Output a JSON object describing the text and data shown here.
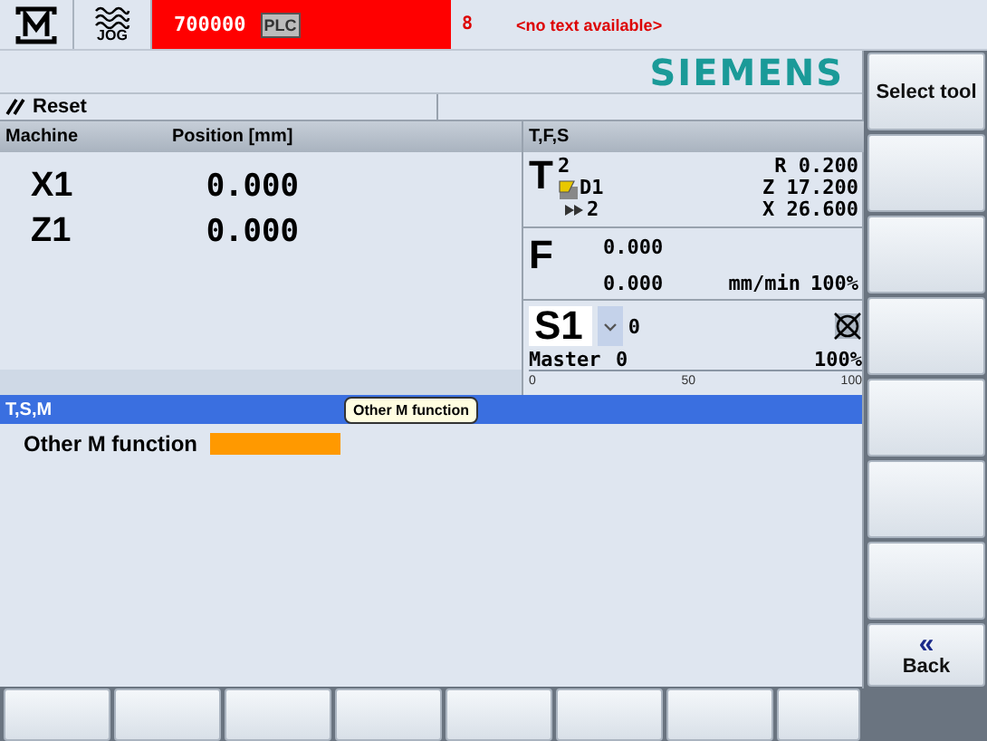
{
  "header": {
    "mode": "JOG",
    "alarm_number": "700000",
    "plc_label": "PLC",
    "alarm_count": "8",
    "alarm_text": "<no text available>"
  },
  "brand": "SIEMENS",
  "channel_status": "Reset",
  "position_table": {
    "columns": [
      "Machine",
      "Position [mm]"
    ],
    "rows": [
      {
        "axis": "X1",
        "value": "0.000"
      },
      {
        "axis": "Z1",
        "value": "0.000"
      }
    ]
  },
  "tfs": {
    "title": "T,F,S",
    "tool": {
      "letter": "T",
      "number": "2",
      "edge": "D1",
      "next": "2",
      "offsets": [
        "R 0.200",
        "Z 17.200",
        "X 26.600"
      ]
    },
    "feed": {
      "letter": "F",
      "actual": "0.000",
      "set": "0.000",
      "unit": "mm/min",
      "override": "100%"
    },
    "spindle": {
      "name": "S1",
      "speed": "0",
      "role": "Master",
      "value": "0",
      "override": "100%",
      "level": 0,
      "scale": [
        "0",
        "50",
        "100"
      ]
    }
  },
  "tsm": {
    "title": "T,S,M",
    "tooltip": "Other M function",
    "fields": [
      {
        "label": "Other M function",
        "highlighted": true
      }
    ]
  },
  "vertical_softkeys": [
    {
      "kind": "labelled",
      "label": "Select tool"
    },
    {
      "kind": "blank"
    },
    {
      "kind": "blank"
    },
    {
      "kind": "blank"
    },
    {
      "kind": "blank"
    },
    {
      "kind": "blank"
    },
    {
      "kind": "blank"
    },
    {
      "kind": "back",
      "label": "Back",
      "symbol": "«"
    }
  ],
  "horizontal_softkeys": [
    {
      "kind": "blank"
    },
    {
      "kind": "blank"
    },
    {
      "kind": "blank"
    },
    {
      "kind": "blank"
    },
    {
      "kind": "blank"
    },
    {
      "kind": "blank"
    },
    {
      "kind": "blank"
    },
    {
      "kind": "blank"
    }
  ]
}
